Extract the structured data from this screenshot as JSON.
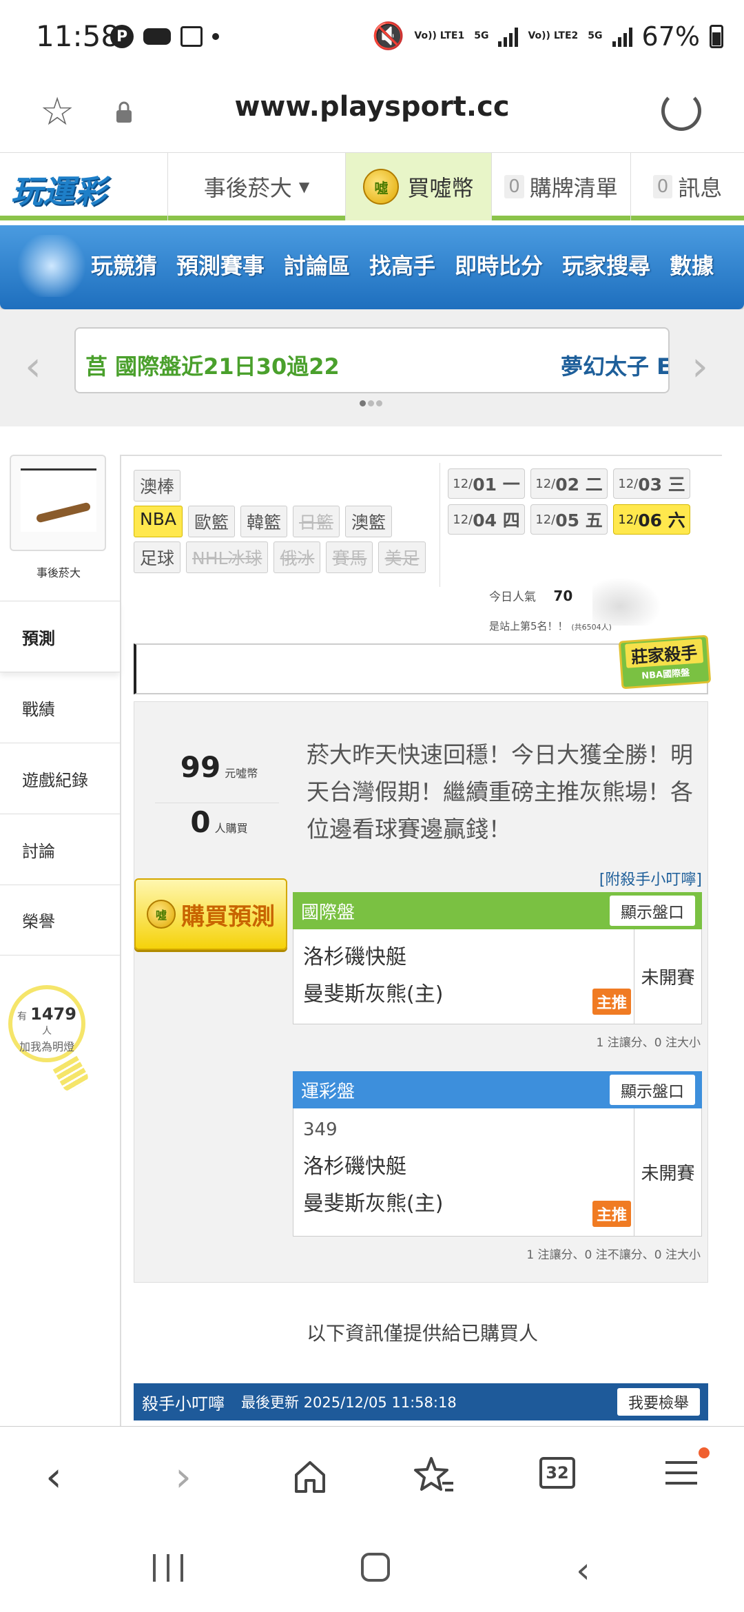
{
  "status_bar": {
    "time": "11:58",
    "p_icon": "P",
    "battery": "67%",
    "lte1": "Vo)) LTE1",
    "lte2": "Vo)) LTE2",
    "net1": "5G",
    "net2": "5G"
  },
  "browser": {
    "url": "www.playsport.cc"
  },
  "site_header": {
    "logo": "玩運彩",
    "user_menu": "事後菸大",
    "buy_coins": "買噓幣",
    "cart_count": "0",
    "cart_label": "購牌清單",
    "msg_count": "0",
    "msg_label": "訊息",
    "coin_glyph": "噓"
  },
  "nav": {
    "items": [
      "玩競猜",
      "預測賽事",
      "討論區",
      "找高手",
      "即時比分",
      "玩家搜尋",
      "數據"
    ]
  },
  "carousel": {
    "text1": "莒 國際盤近21日30過22",
    "text2": "夢幻太子 E"
  },
  "sidebar": {
    "username": "事後菸大",
    "items": [
      "預測",
      "戰績",
      "遊戲紀錄",
      "討論",
      "榮譽"
    ],
    "lamp": {
      "prefix": "有",
      "count": "1479",
      "suffix": "人",
      "text": "加我為明燈"
    }
  },
  "leagues": {
    "row1": [
      "澳棒"
    ],
    "row2": [
      "NBA",
      "歐籃",
      "韓籃",
      "日籃",
      "澳籃"
    ],
    "row3": [
      "足球",
      "NHL冰球",
      "俄冰",
      "賽馬",
      "美足"
    ]
  },
  "dates": {
    "row1": [
      {
        "m": "12/",
        "d": "01 一"
      },
      {
        "m": "12/",
        "d": "02 二"
      },
      {
        "m": "12/",
        "d": "03 三"
      }
    ],
    "row2": [
      {
        "m": "12/",
        "d": "04 四"
      },
      {
        "m": "12/",
        "d": "05 五"
      },
      {
        "m": "12/",
        "d": "06 六"
      }
    ]
  },
  "popularity": {
    "label": "今日人氣",
    "value": "70",
    "rank": "是站上第5名！！",
    "total": "(共6504人)"
  },
  "killer_badge": {
    "title": "莊家殺手",
    "sub": "NBA國際盤"
  },
  "prediction": {
    "price": "99",
    "price_unit": "元噓幣",
    "buyers": "0",
    "buyers_unit": "人購買",
    "buy_button": "購買預測",
    "message": "菸大昨天快速回穩！今日大獲全勝！明天台灣假期！繼續重磅主推灰熊場！各位邊看球賽邊贏錢！",
    "helper_link": "[附殺手小叮嚀]"
  },
  "intl_box": {
    "title": "國際盤",
    "show_btn": "顯示盤口",
    "team1": "洛杉磯快艇",
    "team2": "曼斐斯灰熊(主)",
    "tag": "主推",
    "status": "未開賽",
    "note": "1 注讓分、0 注大小"
  },
  "lottery_box": {
    "title": "運彩盤",
    "show_btn": "顯示盤口",
    "code": "349",
    "team1": "洛杉磯快艇",
    "team2": "曼斐斯灰熊(主)",
    "tag": "主推",
    "status": "未開賽",
    "note": "1 注讓分、0 注不讓分、0 注大小"
  },
  "info_text": "以下資訊僅提供給已購買人",
  "killer_tip": {
    "title": "殺手小叮嚀",
    "updated": "最後更新 2025/12/05 11:58:18",
    "report": "我要檢舉"
  },
  "browser_bottom": {
    "tabs": "32"
  },
  "colors": {
    "green": "#8bc34a",
    "nav_blue": "#1e6fbe",
    "highlight_yellow": "#ffe84d",
    "orange_tag": "#f07b23",
    "tip_bar": "#1e5a9a"
  }
}
